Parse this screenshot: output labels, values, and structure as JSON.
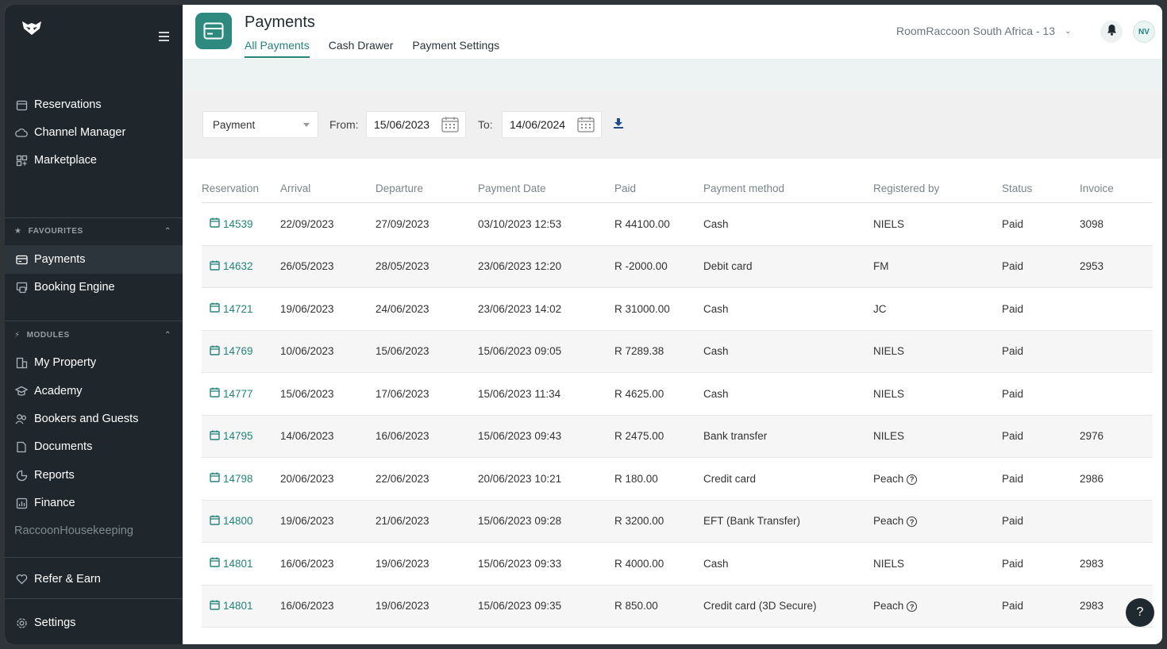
{
  "sidebar": {
    "menu_items_top": [
      {
        "label": "Reservations",
        "icon": "calendar-icon"
      },
      {
        "label": "Channel Manager",
        "icon": "cloud-icon"
      },
      {
        "label": "Marketplace",
        "icon": "apps-icon"
      }
    ],
    "favourites_heading": "FAVOURITES",
    "favourites": [
      {
        "label": "Payments",
        "icon": "card-icon",
        "active": true
      },
      {
        "label": "Booking Engine",
        "icon": "booking-icon"
      }
    ],
    "modules_heading": "MODULES",
    "modules": [
      {
        "label": "My Property",
        "icon": "building-icon"
      },
      {
        "label": "Academy",
        "icon": "graduation-icon"
      },
      {
        "label": "Bookers and Guests",
        "icon": "people-icon"
      },
      {
        "label": "Documents",
        "icon": "document-icon"
      },
      {
        "label": "Reports",
        "icon": "pie-icon"
      },
      {
        "label": "Finance",
        "icon": "finance-icon"
      },
      {
        "label": "RaccoonHousekeeping",
        "icon": "",
        "disabled": true
      }
    ],
    "refer": "Refer & Earn",
    "settings": "Settings"
  },
  "header": {
    "title": "Payments",
    "tabs": [
      "All Payments",
      "Cash Drawer",
      "Payment Settings"
    ],
    "property": "RoomRaccoon South Africa - 13",
    "avatar": "NV"
  },
  "filters": {
    "type": "Payment",
    "from_label": "From:",
    "from": "15/06/2023",
    "to_label": "To:",
    "to": "14/06/2024"
  },
  "table": {
    "columns": [
      "Reservation",
      "Arrival",
      "Departure",
      "Payment Date",
      "Paid",
      "Payment method",
      "Registered by",
      "Status",
      "Invoice"
    ],
    "rows": [
      [
        "14539",
        "22/09/2023",
        "27/09/2023",
        "03/10/2023 12:53",
        "R 44100.00",
        "Cash",
        "NIELS",
        "Paid",
        "3098"
      ],
      [
        "14632",
        "26/05/2023",
        "28/05/2023",
        "23/06/2023 12:20",
        "R -2000.00",
        "Debit card",
        "FM",
        "Paid",
        "2953"
      ],
      [
        "14721",
        "19/06/2023",
        "24/06/2023",
        "23/06/2023 14:02",
        "R 31000.00",
        "Cash",
        "JC",
        "Paid",
        ""
      ],
      [
        "14769",
        "10/06/2023",
        "15/06/2023",
        "15/06/2023 09:05",
        "R 7289.38",
        "Cash",
        "NIELS",
        "Paid",
        ""
      ],
      [
        "14777",
        "15/06/2023",
        "17/06/2023",
        "15/06/2023 11:34",
        "R 4625.00",
        "Cash",
        "NIELS",
        "Paid",
        ""
      ],
      [
        "14795",
        "14/06/2023",
        "16/06/2023",
        "15/06/2023 09:43",
        "R 2475.00",
        "Bank transfer",
        "NILES",
        "Paid",
        "2976"
      ],
      [
        "14798",
        "20/06/2023",
        "22/06/2023",
        "20/06/2023 10:21",
        "R 180.00",
        "Credit card",
        "Peach",
        "Paid",
        "2986"
      ],
      [
        "14800",
        "19/06/2023",
        "21/06/2023",
        "15/06/2023 09:28",
        "R 3200.00",
        "EFT (Bank Transfer)",
        "Peach",
        "Paid",
        ""
      ],
      [
        "14801",
        "16/06/2023",
        "19/06/2023",
        "15/06/2023 09:33",
        "R 4000.00",
        "Cash",
        "NIELS",
        "Paid",
        "2983"
      ],
      [
        "14801",
        "16/06/2023",
        "19/06/2023",
        "15/06/2023 09:35",
        "R 850.00",
        "Credit card (3D Secure)",
        "Peach",
        "Paid",
        "2983"
      ]
    ],
    "help_marked_registrants": [
      "Peach"
    ]
  },
  "help_label": "?",
  "colors": {
    "accent": "#23847a",
    "sidebar": "#20272c",
    "app_icon": "#2e8a7f"
  }
}
